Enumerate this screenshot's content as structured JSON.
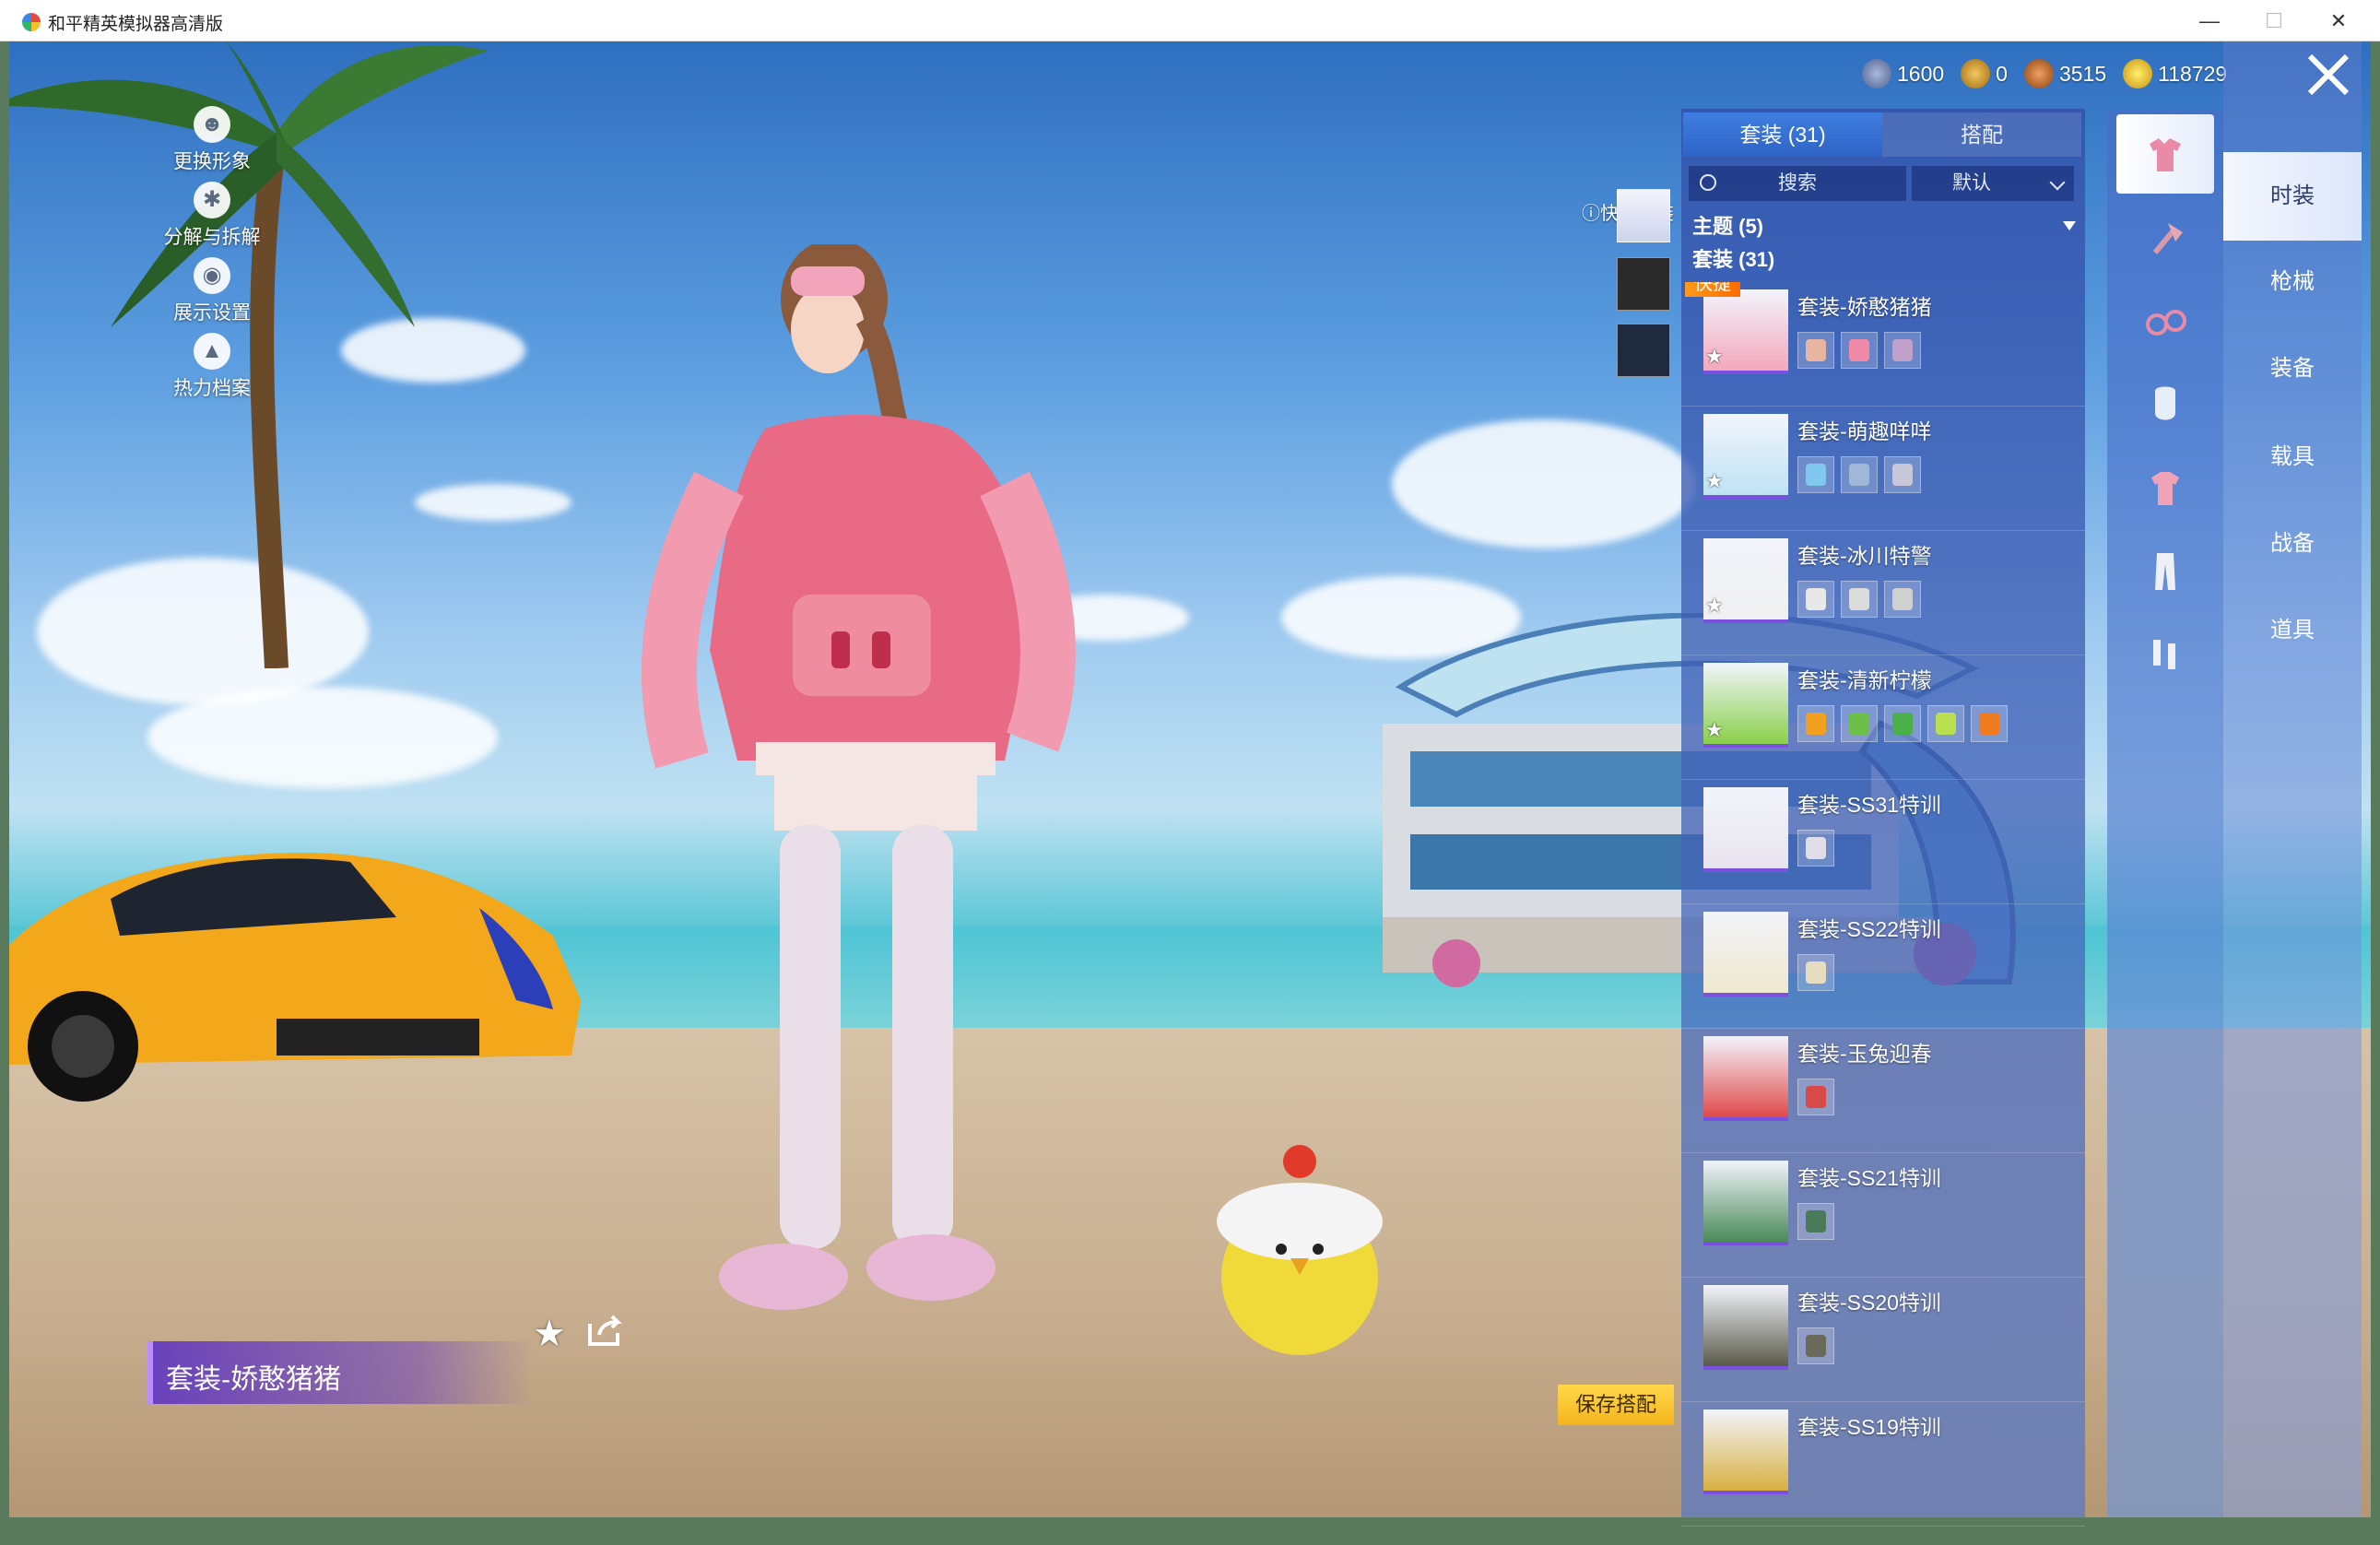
{
  "window": {
    "title": "和平精英模拟器高清版",
    "minimize": "—",
    "maximize": "☐",
    "close": "✕"
  },
  "left_menu": [
    {
      "label": "更换形象",
      "icon": "person-icon"
    },
    {
      "label": "分解与拆解",
      "icon": "puzzle-icon"
    },
    {
      "label": "展示设置",
      "icon": "eye-icon"
    },
    {
      "label": "热力档案",
      "icon": "flame-icon"
    }
  ],
  "currencies": [
    {
      "value": "1600",
      "icon": "silver-coin-icon",
      "color": "#6b7fb0"
    },
    {
      "value": "0",
      "icon": "gold-badge-icon",
      "color": "#d49a1e"
    },
    {
      "value": "3515",
      "icon": "bronze-coin-icon",
      "color": "#b8641c"
    },
    {
      "value": "118729",
      "icon": "lightning-coin-icon",
      "color": "#e0b21a"
    }
  ],
  "quick_change": {
    "label": "快捷换装"
  },
  "panel": {
    "tabs": [
      {
        "label": "套装 (31)",
        "active": true
      },
      {
        "label": "搭配",
        "active": false
      }
    ],
    "search_placeholder": "搜索",
    "sort_label": "默认",
    "theme_header": "主题 (5)",
    "suit_header": "套装 (31)",
    "quick_tag": "快捷"
  },
  "outfits": [
    {
      "name": "套装-娇憨猪猪",
      "starred": true,
      "thumb": "#f4a7bd",
      "parts": [
        "#e8b5a0",
        "#f08aa8",
        "#c0a0c8"
      ]
    },
    {
      "name": "套装-萌趣咩咩",
      "starred": true,
      "thumb": "#bfe3f4",
      "parts": [
        "#7fc8ee",
        "#9fb8d8",
        "#c7c7d8"
      ]
    },
    {
      "name": "套装-冰川特警",
      "starred": true,
      "thumb": "#f0f0f0",
      "parts": [
        "#e8e8e8",
        "#dcdcdc",
        "#d0d0d0"
      ]
    },
    {
      "name": "套装-清新柠檬",
      "starred": true,
      "thumb": "#8ad04a",
      "parts": [
        "#f2a020",
        "#6cc04a",
        "#4cb04a",
        "#b8e050",
        "#f07a20"
      ]
    },
    {
      "name": "套装-SS31特训",
      "starred": false,
      "thumb": "#e8e4ee",
      "parts": [
        "#e0dce8"
      ]
    },
    {
      "name": "套装-SS22特训",
      "starred": false,
      "thumb": "#efe7cf",
      "parts": [
        "#e6dcbf"
      ]
    },
    {
      "name": "套装-玉兔迎春",
      "starred": false,
      "thumb": "#e04a4a",
      "parts": [
        "#d84a4a"
      ]
    },
    {
      "name": "套装-SS21特训",
      "starred": false,
      "thumb": "#4a8a5a",
      "parts": [
        "#4a7a5a"
      ]
    },
    {
      "name": "套装-SS20特训",
      "starred": false,
      "thumb": "#5a5a4a",
      "parts": [
        "#6a6a5a"
      ]
    },
    {
      "name": "套装-SS19特训",
      "starred": false,
      "thumb": "#d8b040",
      "parts": []
    }
  ],
  "icon_tabs": [
    {
      "icon": "outfit-icon",
      "active": true
    },
    {
      "icon": "axe-icon",
      "active": false
    },
    {
      "icon": "glasses-icon",
      "active": false
    },
    {
      "icon": "mask-icon",
      "active": false
    },
    {
      "icon": "shirt-icon",
      "active": false
    },
    {
      "icon": "pants-icon",
      "active": false
    },
    {
      "icon": "shoes-icon",
      "active": false
    }
  ],
  "categories": [
    {
      "label": "时装",
      "active": true
    },
    {
      "label": "枪械",
      "active": false
    },
    {
      "label": "装备",
      "active": false
    },
    {
      "label": "载具",
      "active": false
    },
    {
      "label": "战备",
      "active": false
    },
    {
      "label": "道具",
      "active": false
    }
  ],
  "current_outfit": "套装-娇憨猪猪",
  "save_button": "保存搭配"
}
